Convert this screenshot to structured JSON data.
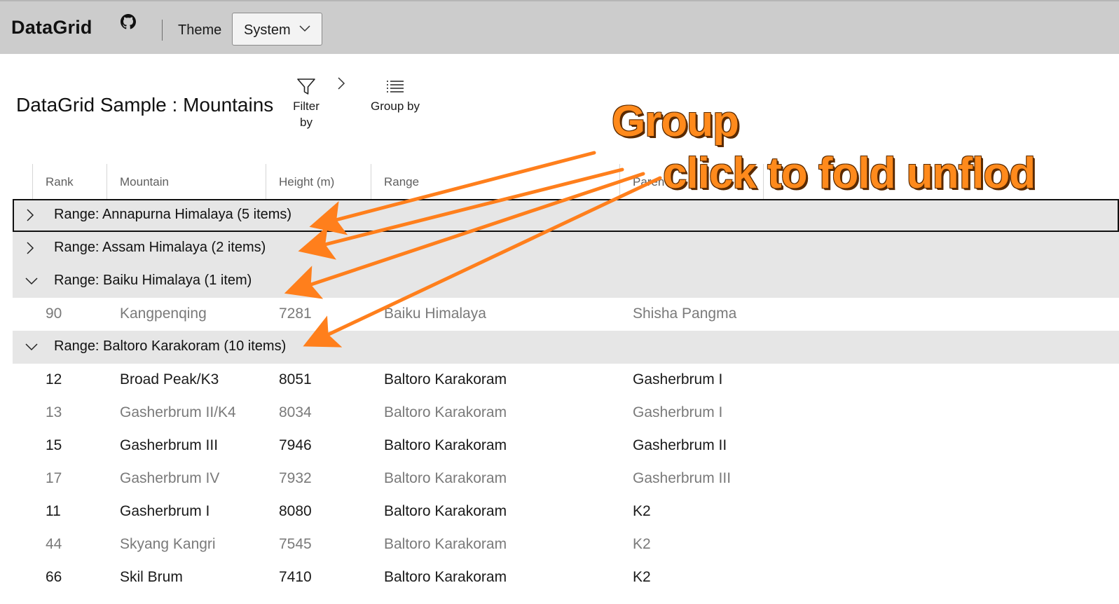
{
  "header": {
    "app_title": "DataGrid",
    "theme_label": "Theme",
    "theme_value": "System"
  },
  "toolbar": {
    "page_title": "DataGrid Sample : Mountains",
    "filter_line1": "Filter",
    "filter_line2": "by",
    "group_label": "Group by"
  },
  "grid": {
    "columns": [
      "Rank",
      "Mountain",
      "Height (m)",
      "Range",
      "Paren"
    ],
    "groups": [
      {
        "label": "Range: Annapurna Himalaya (5 items)",
        "expanded": false
      },
      {
        "label": "Range: Assam Himalaya (2 items)",
        "expanded": false
      },
      {
        "label": "Range: Baiku Himalaya (1 item)",
        "expanded": true
      },
      {
        "label": "Range: Baltoro Karakoram (10 items)",
        "expanded": true
      }
    ],
    "rows": [
      {
        "rank": "90",
        "mountain": "Kangpenqing",
        "height": "7281",
        "range": "Baiku Himalaya",
        "parent": "Shisha Pangma"
      },
      {
        "rank": "12",
        "mountain": "Broad Peak/K3",
        "height": "8051",
        "range": "Baltoro Karakoram",
        "parent": "Gasherbrum I"
      },
      {
        "rank": "13",
        "mountain": "Gasherbrum II/K4",
        "height": "8034",
        "range": "Baltoro Karakoram",
        "parent": "Gasherbrum I"
      },
      {
        "rank": "15",
        "mountain": "Gasherbrum III",
        "height": "7946",
        "range": "Baltoro Karakoram",
        "parent": "Gasherbrum II"
      },
      {
        "rank": "17",
        "mountain": "Gasherbrum IV",
        "height": "7932",
        "range": "Baltoro Karakoram",
        "parent": "Gasherbrum III"
      },
      {
        "rank": "11",
        "mountain": "Gasherbrum I",
        "height": "8080",
        "range": "Baltoro Karakoram",
        "parent": "K2"
      },
      {
        "rank": "44",
        "mountain": "Skyang Kangri",
        "height": "7545",
        "range": "Baltoro Karakoram",
        "parent": "K2"
      },
      {
        "rank": "66",
        "mountain": "Skil Brum",
        "height": "7410",
        "range": "Baltoro Karakoram",
        "parent": "K2"
      }
    ]
  },
  "annotation": {
    "line1": "Group",
    "line2": "click to fold unflod",
    "color": "#ff8a1c"
  }
}
